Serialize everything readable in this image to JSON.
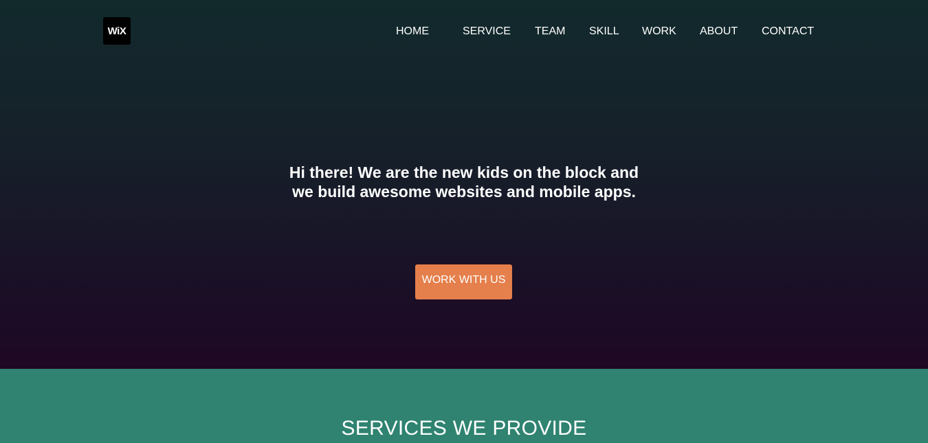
{
  "logo": {
    "text": "WiX"
  },
  "nav": {
    "items": [
      "HOME",
      "SERVICE",
      "TEAM",
      "SKILL",
      "WORK",
      "ABOUT",
      "CONTACT"
    ]
  },
  "hero": {
    "headline": "Hi there! We are the new kids on the block and we build awesome websites and mobile apps.",
    "cta_label": "WORK WITH US"
  },
  "services": {
    "title": "SERVICES WE PROVIDE"
  },
  "colors": {
    "hero_gradient_top": "#122a2c",
    "hero_gradient_bottom": "#1e0723",
    "cta_background": "#e57f4b",
    "services_background": "#2f8370",
    "text": "#ffffff"
  }
}
